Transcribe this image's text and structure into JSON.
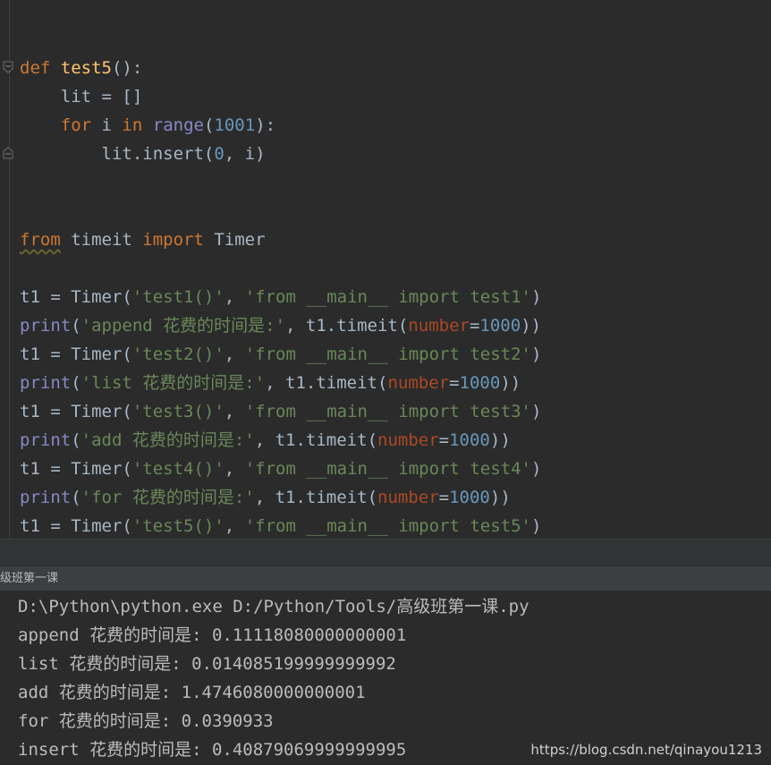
{
  "editor": {
    "lines": [
      {
        "segments": [
          {
            "t": "def",
            "c": "kw"
          },
          {
            "t": " "
          },
          {
            "t": "test5",
            "c": "fn"
          },
          {
            "t": "():"
          }
        ]
      },
      {
        "segments": [
          {
            "t": "    lit = []"
          }
        ]
      },
      {
        "segments": [
          {
            "t": "    "
          },
          {
            "t": "for",
            "c": "kw"
          },
          {
            "t": " i "
          },
          {
            "t": "in",
            "c": "kw"
          },
          {
            "t": " "
          },
          {
            "t": "range",
            "c": "bi"
          },
          {
            "t": "("
          },
          {
            "t": "1001",
            "c": "num"
          },
          {
            "t": "):"
          }
        ]
      },
      {
        "segments": [
          {
            "t": "        lit.insert("
          },
          {
            "t": "0",
            "c": "num"
          },
          {
            "t": ", i)"
          }
        ]
      },
      {
        "segments": []
      },
      {
        "segments": []
      },
      {
        "segments": [
          {
            "t": "from",
            "c": "kw wavy"
          },
          {
            "t": " timeit "
          },
          {
            "t": "import",
            "c": "kw"
          },
          {
            "t": " Timer"
          }
        ]
      },
      {
        "segments": []
      },
      {
        "segments": [
          {
            "t": "t1 = Timer("
          },
          {
            "t": "'test1()'",
            "c": "str"
          },
          {
            "t": ", "
          },
          {
            "t": "'from __main__ import test1'",
            "c": "str"
          },
          {
            "t": ")"
          }
        ]
      },
      {
        "segments": [
          {
            "t": "print",
            "c": "bi"
          },
          {
            "t": "("
          },
          {
            "t": "'append 花费的时间是:'",
            "c": "str"
          },
          {
            "t": ", t1.timeit("
          },
          {
            "t": "number",
            "c": "param"
          },
          {
            "t": "="
          },
          {
            "t": "1000",
            "c": "num"
          },
          {
            "t": "))"
          }
        ]
      },
      {
        "segments": [
          {
            "t": "t1 = Timer("
          },
          {
            "t": "'test2()'",
            "c": "str"
          },
          {
            "t": ", "
          },
          {
            "t": "'from __main__ import test2'",
            "c": "str"
          },
          {
            "t": ")"
          }
        ]
      },
      {
        "segments": [
          {
            "t": "print",
            "c": "bi"
          },
          {
            "t": "("
          },
          {
            "t": "'list 花费的时间是:'",
            "c": "str"
          },
          {
            "t": ", t1.timeit("
          },
          {
            "t": "number",
            "c": "param"
          },
          {
            "t": "="
          },
          {
            "t": "1000",
            "c": "num"
          },
          {
            "t": "))"
          }
        ]
      },
      {
        "segments": [
          {
            "t": "t1 = Timer("
          },
          {
            "t": "'test3()'",
            "c": "str"
          },
          {
            "t": ", "
          },
          {
            "t": "'from __main__ import test3'",
            "c": "str"
          },
          {
            "t": ")"
          }
        ]
      },
      {
        "segments": [
          {
            "t": "print",
            "c": "bi"
          },
          {
            "t": "("
          },
          {
            "t": "'add 花费的时间是:'",
            "c": "str"
          },
          {
            "t": ", t1.timeit("
          },
          {
            "t": "number",
            "c": "param"
          },
          {
            "t": "="
          },
          {
            "t": "1000",
            "c": "num"
          },
          {
            "t": "))"
          }
        ]
      },
      {
        "segments": [
          {
            "t": "t1 = Timer("
          },
          {
            "t": "'test4()'",
            "c": "str"
          },
          {
            "t": ", "
          },
          {
            "t": "'from __main__ import test4'",
            "c": "str"
          },
          {
            "t": ")"
          }
        ]
      },
      {
        "segments": [
          {
            "t": "print",
            "c": "bi"
          },
          {
            "t": "("
          },
          {
            "t": "'for 花费的时间是:'",
            "c": "str"
          },
          {
            "t": ", t1.timeit("
          },
          {
            "t": "number",
            "c": "param"
          },
          {
            "t": "="
          },
          {
            "t": "1000",
            "c": "num"
          },
          {
            "t": "))"
          }
        ]
      },
      {
        "segments": [
          {
            "t": "t1 = Timer("
          },
          {
            "t": "'test5()'",
            "c": "str"
          },
          {
            "t": ", "
          },
          {
            "t": "'from __main__ import test5'",
            "c": "str"
          },
          {
            "t": ")"
          }
        ]
      }
    ]
  },
  "run_panel": {
    "title": "级班第一课"
  },
  "console": {
    "lines": [
      "D:\\Python\\python.exe D:/Python/Tools/高级班第一课.py",
      "append 花费的时间是: 0.11118080000000001",
      "list 花费的时间是: 0.014085199999999992",
      "add 花费的时间是: 1.4746080000000001",
      "for 花费的时间是: 0.0390933",
      "insert 花费的时间是: 0.40879069999999995"
    ]
  },
  "watermark": "https://blog.csdn.net/qinayou1213",
  "colors": {
    "background": "#2b2b2b",
    "keyword": "#cc7832",
    "function": "#ffc66d",
    "builtin": "#8888c6",
    "number": "#6897bb",
    "string": "#6a8759",
    "parameter": "#aa4926",
    "text": "#a9b7c6"
  },
  "icons": [
    "fold-open-icon",
    "fold-close-icon"
  ]
}
